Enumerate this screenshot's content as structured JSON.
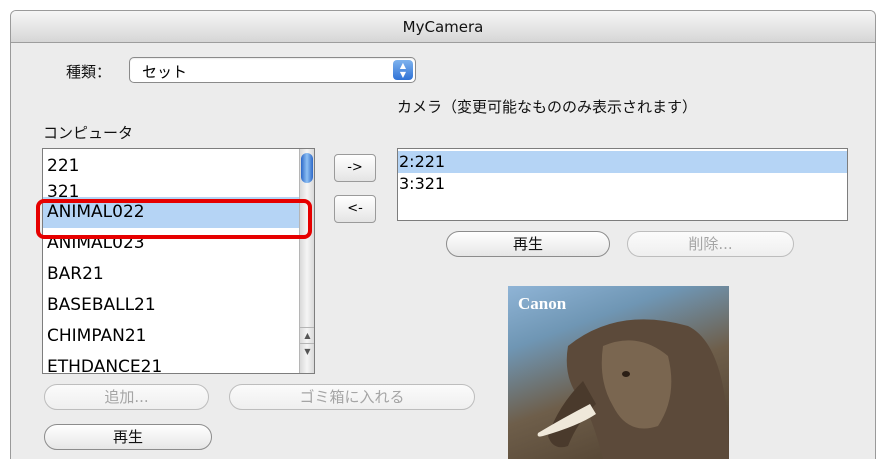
{
  "window": {
    "title": "MyCamera"
  },
  "type_selector": {
    "label": "種類：",
    "value": "セット"
  },
  "camera": {
    "label": "カメラ（変更可能なもののみ表示されます）",
    "items": [
      {
        "label": "2:221",
        "selected": true
      },
      {
        "label": "3:321",
        "selected": false
      }
    ],
    "play_button": "再生",
    "delete_button": "削除..."
  },
  "computer": {
    "label": "コンピュータ",
    "items": [
      {
        "label": "221"
      },
      {
        "label": "321"
      },
      {
        "label": "ANIMAL022",
        "selected": true
      },
      {
        "label": "ANIMAL023"
      },
      {
        "label": "BAR21"
      },
      {
        "label": "BASEBALL21"
      },
      {
        "label": "CHIMPAN21"
      },
      {
        "label": "ETHDANCE21"
      }
    ],
    "add_button": "追加...",
    "trash_button": "ゴミ箱に入れる",
    "play_button": "再生"
  },
  "transfer": {
    "to_camera": "->",
    "to_computer": "<-"
  },
  "preview": {
    "brand": "Canon"
  },
  "colors": {
    "selection": "#b5d4f5",
    "highlight": "#e60000",
    "accent": "#2f72d6"
  }
}
